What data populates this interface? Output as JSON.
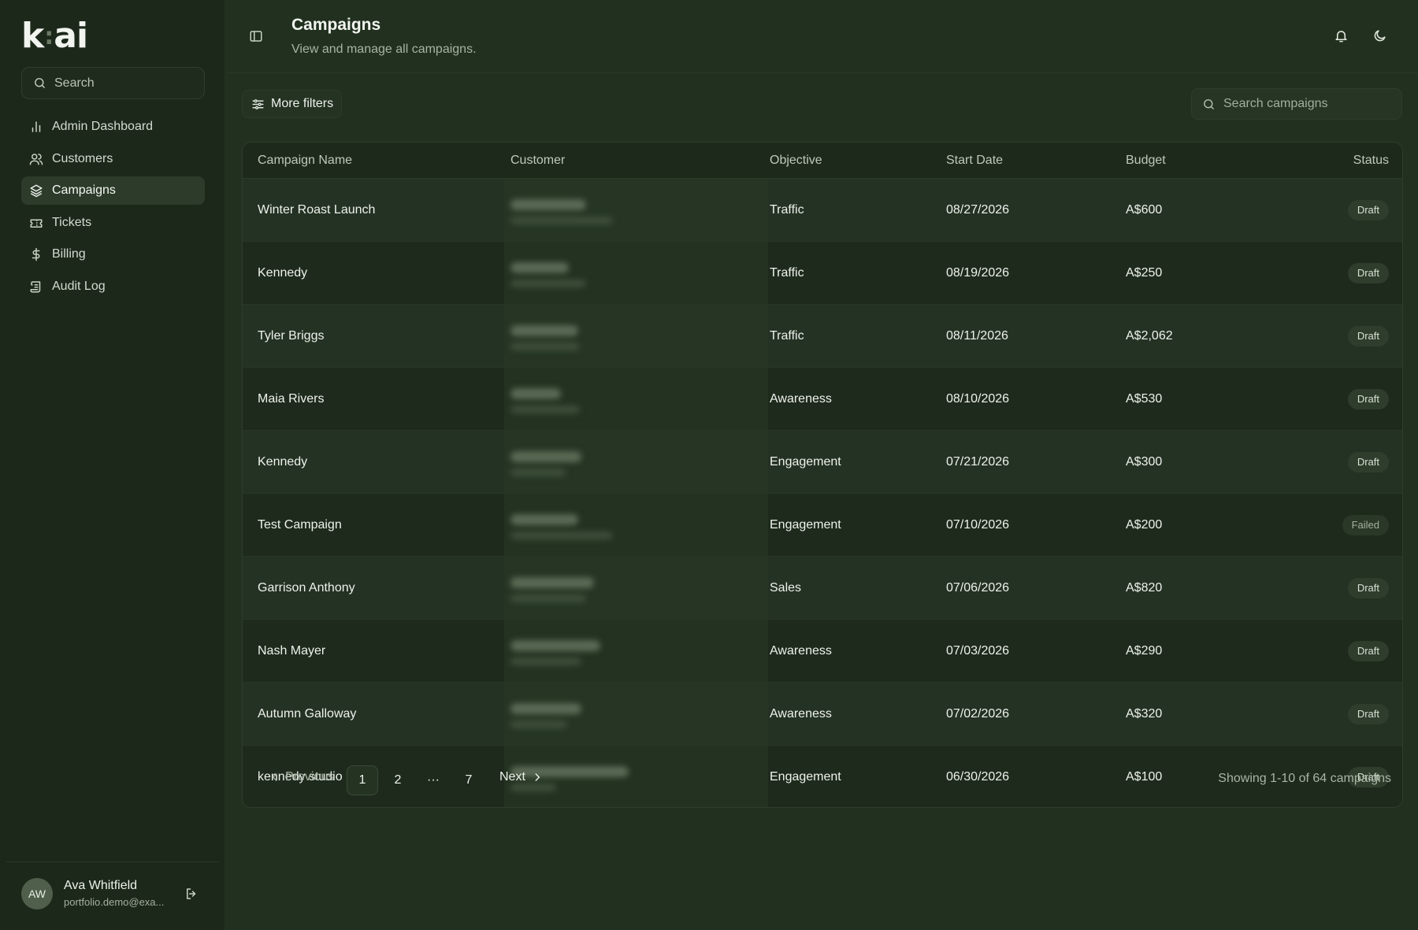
{
  "brand": {
    "logo_left": "k",
    "logo_dots": ":",
    "logo_right": "ai"
  },
  "sidebar": {
    "search_placeholder": "Search",
    "items": [
      {
        "label": "Admin Dashboard",
        "icon": "bar-chart-icon",
        "active": false
      },
      {
        "label": "Customers",
        "icon": "users-icon",
        "active": false
      },
      {
        "label": "Campaigns",
        "icon": "layers-icon",
        "active": true
      },
      {
        "label": "Tickets",
        "icon": "ticket-icon",
        "active": false
      },
      {
        "label": "Billing",
        "icon": "dollar-icon",
        "active": false
      },
      {
        "label": "Audit Log",
        "icon": "scroll-icon",
        "active": false
      }
    ],
    "user": {
      "initials": "AW",
      "name": "Ava Whitfield",
      "email": "portfolio.demo@exa..."
    }
  },
  "header": {
    "title": "Campaigns",
    "subtitle": "View and manage all campaigns."
  },
  "toolbar": {
    "more_filters": "More filters",
    "search_placeholder": "Search campaigns"
  },
  "table": {
    "columns": [
      "Campaign Name",
      "Customer",
      "Objective",
      "Start Date",
      "Budget",
      "Status"
    ],
    "rows": [
      {
        "name": "Winter Roast Launch",
        "objective": "Traffic",
        "start": "08/27/2026",
        "budget": "A$600",
        "status": "Draft"
      },
      {
        "name": "Kennedy",
        "objective": "Traffic",
        "start": "08/19/2026",
        "budget": "A$250",
        "status": "Draft"
      },
      {
        "name": "Tyler Briggs",
        "objective": "Traffic",
        "start": "08/11/2026",
        "budget": "A$2,062",
        "status": "Draft"
      },
      {
        "name": "Maia Rivers",
        "objective": "Awareness",
        "start": "08/10/2026",
        "budget": "A$530",
        "status": "Draft"
      },
      {
        "name": "Kennedy",
        "objective": "Engagement",
        "start": "07/21/2026",
        "budget": "A$300",
        "status": "Draft"
      },
      {
        "name": "Test Campaign",
        "objective": "Engagement",
        "start": "07/10/2026",
        "budget": "A$200",
        "status": "Failed"
      },
      {
        "name": "Garrison Anthony",
        "objective": "Sales",
        "start": "07/06/2026",
        "budget": "A$820",
        "status": "Draft"
      },
      {
        "name": "Nash Mayer",
        "objective": "Awareness",
        "start": "07/03/2026",
        "budget": "A$290",
        "status": "Draft"
      },
      {
        "name": "Autumn Galloway",
        "objective": "Awareness",
        "start": "07/02/2026",
        "budget": "A$320",
        "status": "Draft"
      },
      {
        "name": "kennedy studio",
        "objective": "Engagement",
        "start": "06/30/2026",
        "budget": "A$100",
        "status": "Draft"
      }
    ]
  },
  "pagination": {
    "previous": "Previous",
    "pages": [
      "1",
      "2",
      "···",
      "7"
    ],
    "current": "1",
    "next": "Next",
    "summary": "Showing 1-10 of 64 campaigns"
  }
}
